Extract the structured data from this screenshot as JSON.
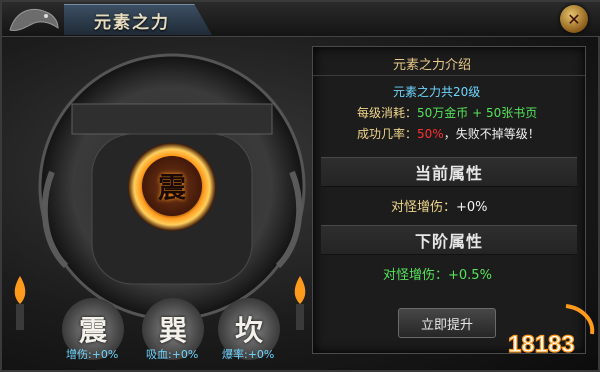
{
  "title": "元素之力",
  "intro": {
    "heading": "元素之力介绍",
    "levels": "元素之力共20级",
    "cost_label": "每级消耗：",
    "cost_value": "50万金币 + 50张书页",
    "rate_label": "成功几率：",
    "rate_value": "50%",
    "rate_note": "，失败不掉等级！"
  },
  "current": {
    "heading": "当前属性",
    "label": "对怪增伤：",
    "value": "+0%"
  },
  "next": {
    "heading": "下阶属性",
    "label": "对怪增伤：",
    "value": "+0.5%"
  },
  "upgrade_button": "立即提升",
  "center_rune": "震",
  "runes": [
    {
      "glyph": "震",
      "caption": "增伤:+0%"
    },
    {
      "glyph": "巽",
      "caption": "吸血:+0%"
    },
    {
      "glyph": "坎",
      "caption": "爆率:+0%"
    }
  ],
  "watermark": "18183",
  "colors": {
    "gold": "#e8c98a",
    "cyan": "#6fd6ff",
    "green": "#55e45a",
    "red": "#ff3030",
    "fire": "#ff9a1c"
  }
}
